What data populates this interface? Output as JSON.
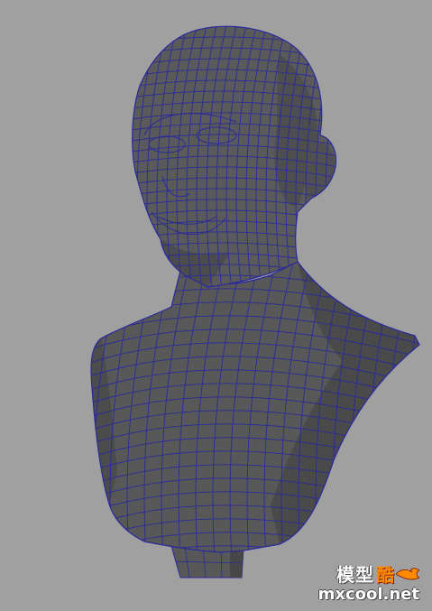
{
  "viewport": {
    "background": "#a0a0a0",
    "mesh_fill": "#585858",
    "mesh_shade": "#484848",
    "wire_color": "#2a2a9a"
  },
  "model": {
    "name": "head-bust-wireframe"
  },
  "watermark": {
    "chinese": "模型",
    "brand": "酷",
    "url": "mxcool.net",
    "accent": "#ff8a00"
  }
}
